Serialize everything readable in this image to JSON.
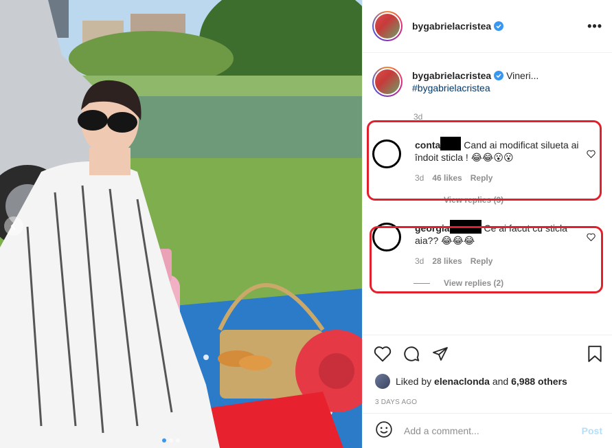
{
  "post": {
    "username": "bygabrielacristea",
    "more_label": "•••"
  },
  "caption": {
    "username": "bygabrielacristea",
    "text": "Vineri...",
    "hashtag": "#bygabrielacristea",
    "time": "3d"
  },
  "comments": [
    {
      "username": "conta",
      "text": "Cand ai modificat silueta ai îndoit sticla ! 😂😂😮😮",
      "time": "3d",
      "likes": "46 likes",
      "reply_label": "Reply",
      "view_replies": "View replies (3)"
    },
    {
      "username": "georgia",
      "text": "Ce ai facut cu sticla aia?? 😂😂😂",
      "time": "3d",
      "likes": "28 likes",
      "reply_label": "Reply",
      "view_replies": "View replies (2)"
    }
  ],
  "likes": {
    "prefix": "Liked by",
    "user": "elenaclonda",
    "middle": "and",
    "others": "6,988 others"
  },
  "timestamp": "3 DAYS AGO",
  "add_comment": {
    "placeholder": "Add a comment...",
    "post_label": "Post"
  },
  "colors": {
    "verified": "#3897f0",
    "highlight": "#e0202a",
    "link": "#00376b"
  },
  "icons": [
    "chevron-left-icon",
    "more-icon",
    "verified-icon",
    "heart-icon",
    "comment-icon",
    "share-icon",
    "bookmark-icon",
    "emoji-icon"
  ]
}
